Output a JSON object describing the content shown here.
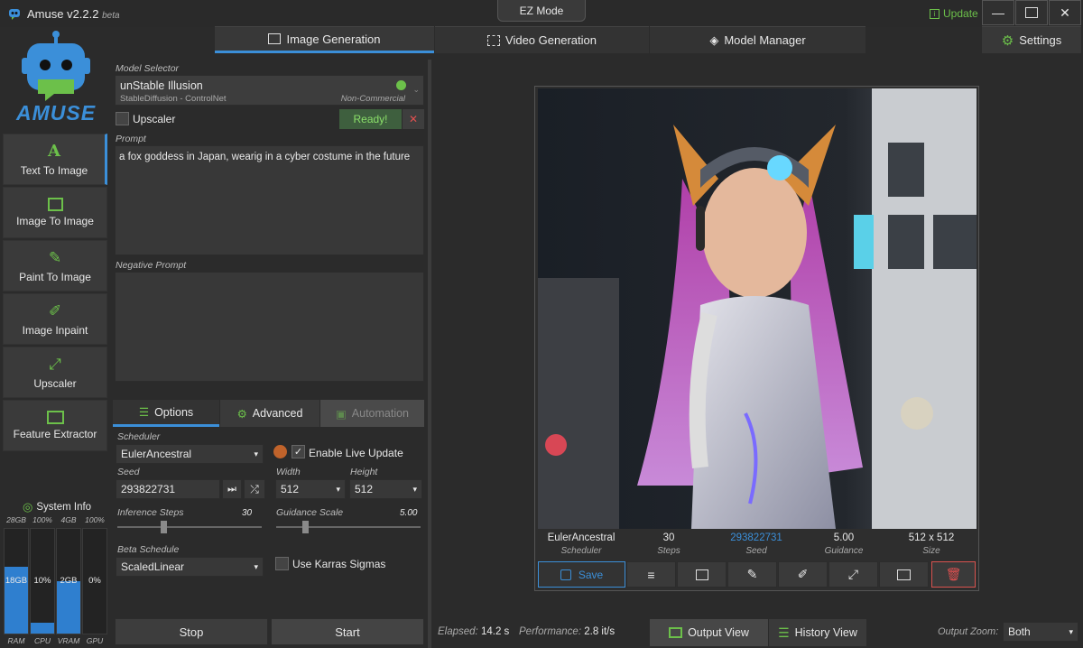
{
  "app": {
    "title": "Amuse v2.2.2",
    "beta": "beta",
    "ez_mode": "EZ Mode",
    "update": "Update",
    "logo_text": "AMUSE"
  },
  "colors": {
    "accent": "#3b8fd9",
    "green": "#4caf50",
    "red": "#d9534f"
  },
  "tabs": [
    {
      "label": "Image Generation",
      "icon": "image-icon"
    },
    {
      "label": "Video Generation",
      "icon": "film-icon"
    },
    {
      "label": "Model Manager",
      "icon": "layers-icon"
    }
  ],
  "settings_label": "Settings",
  "sidebar": {
    "items": [
      {
        "label": "Text To Image",
        "icon": "text-icon"
      },
      {
        "label": "Image To Image",
        "icon": "image-icon"
      },
      {
        "label": "Paint To Image",
        "icon": "brush-icon"
      },
      {
        "label": "Image Inpaint",
        "icon": "edit-icon"
      },
      {
        "label": "Upscaler",
        "icon": "expand-icon"
      },
      {
        "label": "Feature Extractor",
        "icon": "picture-icon"
      }
    ]
  },
  "sysinfo": {
    "title": "System Info",
    "cols": [
      {
        "top": "28GB",
        "value": "18GB",
        "name": "RAM",
        "fill": 0.64
      },
      {
        "top": "100%",
        "value": "10%",
        "name": "CPU",
        "fill": 0.1
      },
      {
        "top": "4GB",
        "value": "2GB",
        "name": "VRAM",
        "fill": 0.5
      },
      {
        "top": "100%",
        "value": "0%",
        "name": "GPU",
        "fill": 0.0
      }
    ]
  },
  "model": {
    "label": "Model Selector",
    "name": "unStable Illusion",
    "sub": "StableDiffusion - ControlNet",
    "license": "Non-Commercial",
    "upscaler": "Upscaler",
    "ready": "Ready!"
  },
  "prompt": {
    "label": "Prompt",
    "value": "a fox goddess in Japan, wearig in a cyber costume in the future"
  },
  "negative": {
    "label": "Negative Prompt",
    "value": ""
  },
  "subtabs": [
    "Options",
    "Advanced",
    "Automation"
  ],
  "options": {
    "scheduler_label": "Scheduler",
    "scheduler": "EulerAncestral",
    "live_update": "Enable Live Update",
    "seed_label": "Seed",
    "seed": "293822731",
    "width_label": "Width",
    "width": "512",
    "height_label": "Height",
    "height": "512",
    "steps_label": "Inference Steps",
    "steps": "30",
    "steps_level": 0.3,
    "guidance_label": "Guidance Scale",
    "guidance": "5.00",
    "guidance_level": 0.18,
    "beta_label": "Beta Schedule",
    "beta": "ScaledLinear",
    "karras": "Use Karras Sigmas"
  },
  "actions": {
    "stop": "Stop",
    "start": "Start"
  },
  "result": {
    "scheduler": "EulerAncestral",
    "scheduler_l": "Scheduler",
    "steps": "30",
    "steps_l": "Steps",
    "seed": "293822731",
    "seed_l": "Seed",
    "guidance": "5.00",
    "guidance_l": "Guidance",
    "size": "512 x 512",
    "size_l": "Size",
    "save": "Save"
  },
  "footer": {
    "elapsed_l": "Elapsed:",
    "elapsed": "14.2 s",
    "perf_l": "Performance:",
    "perf": "2.8 it/s",
    "output_view": "Output View",
    "history_view": "History View",
    "zoom_l": "Output Zoom:",
    "zoom": "Both"
  }
}
